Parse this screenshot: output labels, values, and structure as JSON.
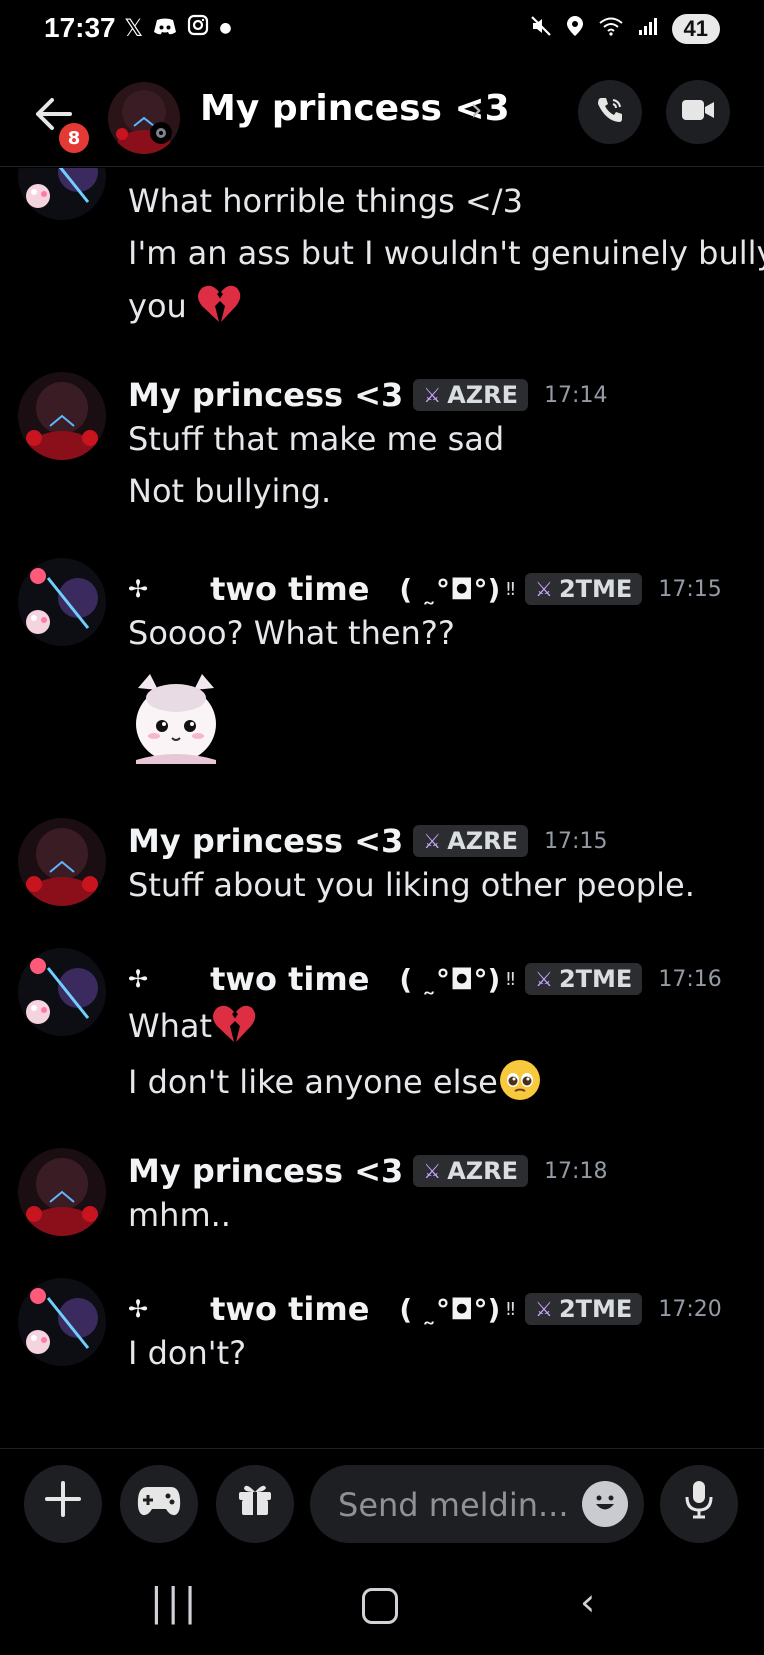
{
  "status_bar": {
    "time": "17:37",
    "left_icons": [
      "x-icon",
      "discord-icon",
      "instagram-icon",
      "dot-icon"
    ],
    "right_icons": [
      "mute-icon",
      "location-icon",
      "wifi-icon",
      "signal-icon"
    ],
    "battery": "41"
  },
  "header": {
    "back_badge": "8",
    "title": "My princess <3",
    "chevron": "›"
  },
  "messages": [
    {
      "id": "m0",
      "lines": [
        "What horrible things </3",
        "I'm an ass but I wouldn't genuinely bully",
        "you"
      ],
      "trailing_emoji": "broken-heart"
    },
    {
      "id": "m1",
      "author": "My princess <3",
      "tag": "AZRE",
      "time": "17:14",
      "lines": [
        "Stuff that make me sad",
        "Not bullying."
      ]
    },
    {
      "id": "m2",
      "author": "two time",
      "author_prefix": "✢",
      "kaomoji": "( ˷°◘°)",
      "kaomoji_suffix": "‼",
      "tag": "2TME",
      "time": "17:15",
      "lines": [
        "Soooo? What then??"
      ],
      "sticker": "white-cat-girl-sticker"
    },
    {
      "id": "m3",
      "author": "My princess <3",
      "tag": "AZRE",
      "time": "17:15",
      "lines": [
        "Stuff about you liking other people."
      ]
    },
    {
      "id": "m4",
      "author": "two time",
      "author_prefix": "✢",
      "kaomoji": "( ˷°◘°)",
      "kaomoji_suffix": "‼",
      "tag": "2TME",
      "time": "17:16",
      "lines": [
        "What",
        "I don't like anyone else"
      ]
    },
    {
      "id": "m5",
      "author": "My princess <3",
      "tag": "AZRE",
      "time": "17:18",
      "lines": [
        "mhm.."
      ]
    },
    {
      "id": "m6",
      "author": "two time",
      "author_prefix": "✢",
      "kaomoji": "( ˷°◘°)",
      "kaomoji_suffix": "‼",
      "tag": "2TME",
      "time": "17:20",
      "lines": [
        "I don't?"
      ]
    }
  ],
  "composer": {
    "placeholder": "Send meldin...",
    "plus_label": "+"
  },
  "navbar": {
    "recents": "|||",
    "back": "‹"
  },
  "colors": {
    "background": "#000000",
    "badge": "#e53935",
    "tag_bg": "#2b2d31",
    "timestamp": "#949ba4"
  }
}
